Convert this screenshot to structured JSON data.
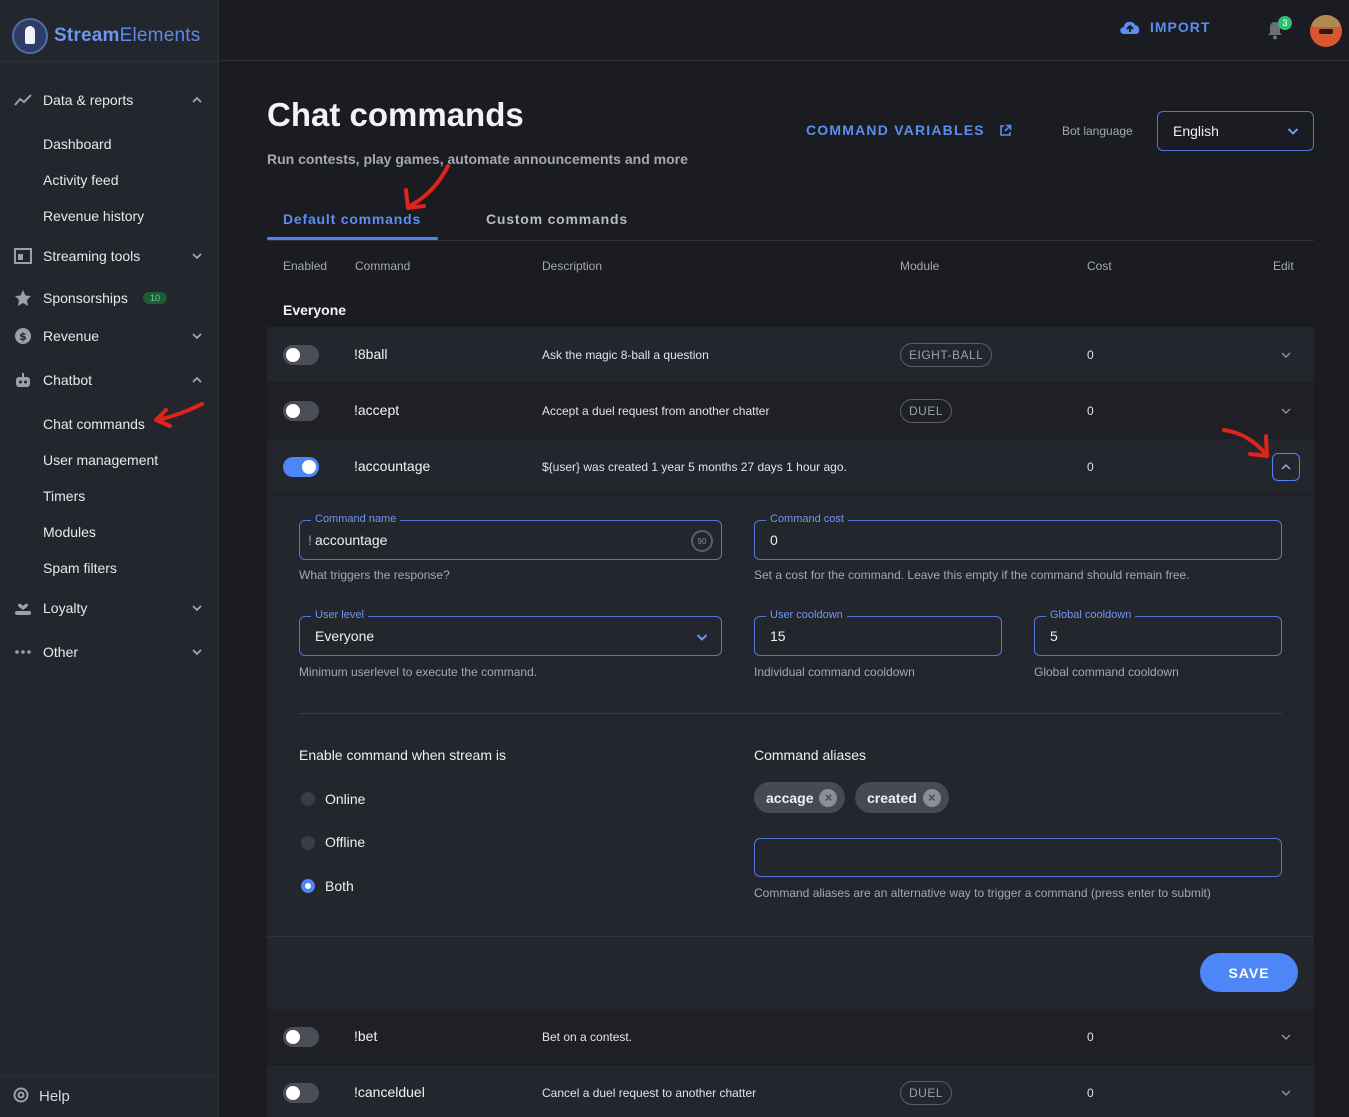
{
  "brand": {
    "name_bold": "Stream",
    "name_rest": "Elements"
  },
  "sidebar": {
    "data_reports": "Data & reports",
    "dashboard": "Dashboard",
    "activity_feed": "Activity feed",
    "revenue_history": "Revenue history",
    "streaming_tools": "Streaming tools",
    "sponsorships": "Sponsorships",
    "sponsorships_badge": "10",
    "revenue": "Revenue",
    "chatbot": "Chatbot",
    "chat_commands": "Chat commands",
    "user_management": "User management",
    "timers": "Timers",
    "modules": "Modules",
    "spam_filters": "Spam filters",
    "loyalty": "Loyalty",
    "other": "Other",
    "help": "Help"
  },
  "topbar": {
    "import_label": "IMPORT",
    "notification_count": "3"
  },
  "header": {
    "title": "Chat commands",
    "subtitle": "Run contests, play games, automate announcements and more",
    "command_variables": "COMMAND VARIABLES",
    "bot_language_label": "Bot language",
    "bot_language_value": "English"
  },
  "tabs": {
    "default": "Default commands",
    "custom": "Custom commands"
  },
  "table": {
    "headers": {
      "enabled": "Enabled",
      "command": "Command",
      "description": "Description",
      "module": "Module",
      "cost": "Cost",
      "edit": "Edit"
    },
    "group": "Everyone",
    "rows": [
      {
        "command": "!8ball",
        "description": "Ask the magic 8-ball a question",
        "module": "EIGHT-BALL",
        "cost": "0",
        "enabled": false
      },
      {
        "command": "!accept",
        "description": "Accept a duel request from another chatter",
        "module": "DUEL",
        "cost": "0",
        "enabled": false
      },
      {
        "command": "!accountage",
        "description": "${user} was created 1 year 5 months 27 days 1 hour ago.",
        "module": "",
        "cost": "0",
        "enabled": true
      },
      {
        "command": "!bet",
        "description": "Bet on a contest.",
        "module": "",
        "cost": "0",
        "enabled": false
      },
      {
        "command": "!cancelduel",
        "description": "Cancel a duel request to another chatter",
        "module": "DUEL",
        "cost": "0",
        "enabled": false
      }
    ]
  },
  "editor": {
    "command_name_label": "Command name",
    "command_name_prefix": "!",
    "command_name_value": "accountage",
    "command_name_counter": "90",
    "command_name_help": "What triggers the response?",
    "command_cost_label": "Command cost",
    "command_cost_value": "0",
    "command_cost_help": "Set a cost for the command. Leave this empty if the command should remain free.",
    "user_level_label": "User level",
    "user_level_value": "Everyone",
    "user_level_help": "Minimum userlevel to execute the command.",
    "user_cooldown_label": "User cooldown",
    "user_cooldown_value": "15",
    "user_cooldown_help": "Individual command cooldown",
    "global_cooldown_label": "Global cooldown",
    "global_cooldown_value": "5",
    "global_cooldown_help": "Global command cooldown",
    "stream_section_title": "Enable command when stream is",
    "stream_options": [
      "Online",
      "Offline",
      "Both"
    ],
    "stream_selected": "Both",
    "aliases_title": "Command aliases",
    "aliases": [
      "accage",
      "created"
    ],
    "aliases_input_value": "",
    "aliases_help": "Command aliases are an alternative way to trigger a command (press enter to submit)",
    "save_label": "SAVE"
  },
  "colors": {
    "accent": "#4f86f7",
    "background": "#1b1c21",
    "panel": "#24262d",
    "annotation": "#e0241b"
  }
}
